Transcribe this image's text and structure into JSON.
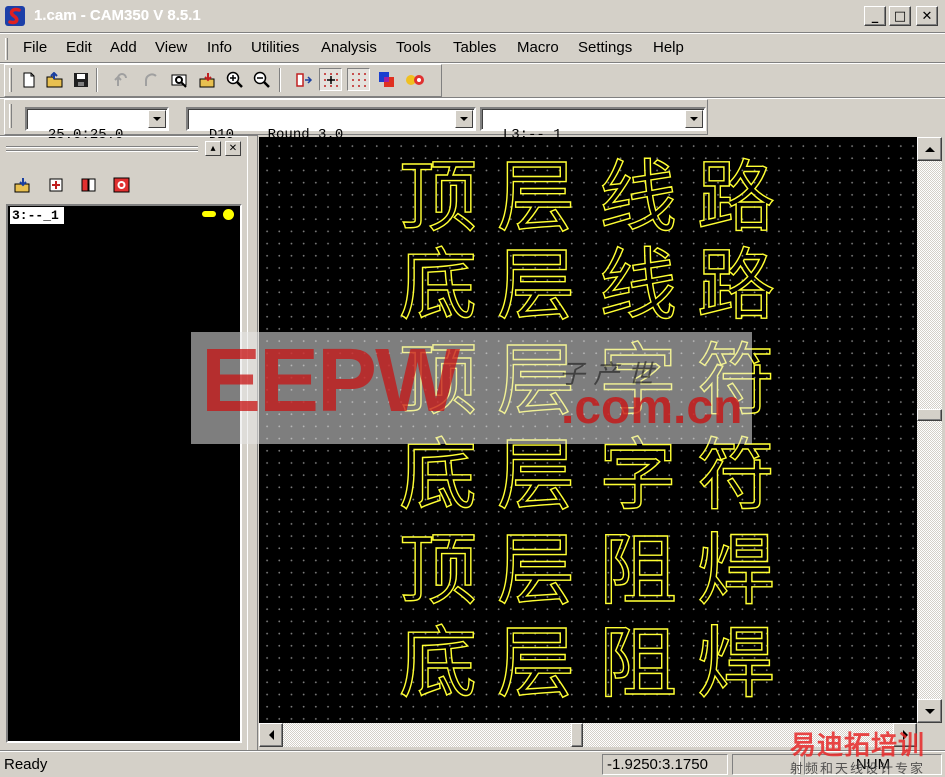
{
  "window": {
    "title": "1.cam - CAM350 V 8.5.1",
    "buttons": {
      "minimize": "_",
      "maximize": "□",
      "close": "✕"
    }
  },
  "menu": [
    "File",
    "Edit",
    "Add",
    "View",
    "Info",
    "Utilities",
    "Analysis",
    "Tools",
    "Tables",
    "Macro",
    "Settings",
    "Help"
  ],
  "toolbar": {
    "icons": [
      "new-file-icon",
      "open-file-icon",
      "save-icon",
      "undo-icon",
      "redo-icon",
      "find-icon",
      "import-icon",
      "zoom-in-icon",
      "zoom-out-icon",
      "flip-icon",
      "grid-snap-icon",
      "grid-dots-icon",
      "layer-colors-icon",
      "flash-icon"
    ]
  },
  "selectors": {
    "grid": "25.0:25.0",
    "aperture": "D10    Round 3.0",
    "layer": "L3:--_1"
  },
  "layer_panel": {
    "icons": [
      "import-layer-icon",
      "add-layer-icon",
      "layers-book-icon",
      "record-layer-icon"
    ],
    "items": [
      {
        "label": "3:--_1",
        "color": "#ffff00"
      }
    ]
  },
  "canvas": {
    "background": "#000000",
    "trace_color": "#ffff33",
    "rows": [
      [
        "顶",
        "层",
        "线",
        "路"
      ],
      [
        "底",
        "层",
        "线",
        "路"
      ],
      [
        "顶",
        "层",
        "字",
        "符"
      ],
      [
        "底",
        "层",
        "字",
        "符"
      ],
      [
        "顶",
        "层",
        "阻",
        "焊"
      ],
      [
        "底",
        "层",
        "阻",
        "焊"
      ]
    ]
  },
  "watermark": {
    "logo": "EEPW",
    "domain": ".com.cn",
    "chinese": "子 产 世"
  },
  "site_mark": {
    "title": "易迪拓培训",
    "subtitle": "射频和天线设计专家"
  },
  "status": {
    "message": "Ready",
    "coordinates": "-1.9250:3.1750",
    "num_lock": "NUM"
  }
}
